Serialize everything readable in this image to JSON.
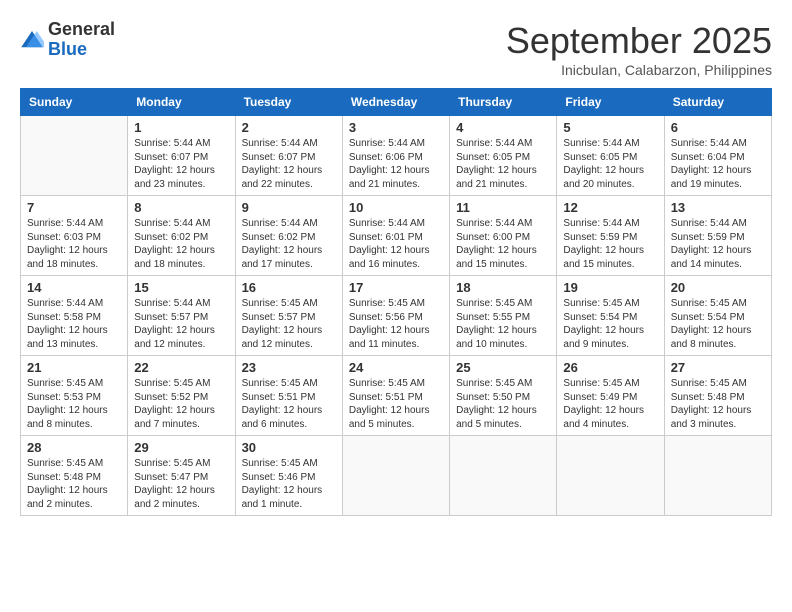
{
  "logo": {
    "general": "General",
    "blue": "Blue"
  },
  "title": "September 2025",
  "location": "Inicbulan, Calabarzon, Philippines",
  "days_of_week": [
    "Sunday",
    "Monday",
    "Tuesday",
    "Wednesday",
    "Thursday",
    "Friday",
    "Saturday"
  ],
  "weeks": [
    [
      {
        "day": "",
        "info": ""
      },
      {
        "day": "1",
        "info": "Sunrise: 5:44 AM\nSunset: 6:07 PM\nDaylight: 12 hours\nand 23 minutes."
      },
      {
        "day": "2",
        "info": "Sunrise: 5:44 AM\nSunset: 6:07 PM\nDaylight: 12 hours\nand 22 minutes."
      },
      {
        "day": "3",
        "info": "Sunrise: 5:44 AM\nSunset: 6:06 PM\nDaylight: 12 hours\nand 21 minutes."
      },
      {
        "day": "4",
        "info": "Sunrise: 5:44 AM\nSunset: 6:05 PM\nDaylight: 12 hours\nand 21 minutes."
      },
      {
        "day": "5",
        "info": "Sunrise: 5:44 AM\nSunset: 6:05 PM\nDaylight: 12 hours\nand 20 minutes."
      },
      {
        "day": "6",
        "info": "Sunrise: 5:44 AM\nSunset: 6:04 PM\nDaylight: 12 hours\nand 19 minutes."
      }
    ],
    [
      {
        "day": "7",
        "info": "Sunrise: 5:44 AM\nSunset: 6:03 PM\nDaylight: 12 hours\nand 18 minutes."
      },
      {
        "day": "8",
        "info": "Sunrise: 5:44 AM\nSunset: 6:02 PM\nDaylight: 12 hours\nand 18 minutes."
      },
      {
        "day": "9",
        "info": "Sunrise: 5:44 AM\nSunset: 6:02 PM\nDaylight: 12 hours\nand 17 minutes."
      },
      {
        "day": "10",
        "info": "Sunrise: 5:44 AM\nSunset: 6:01 PM\nDaylight: 12 hours\nand 16 minutes."
      },
      {
        "day": "11",
        "info": "Sunrise: 5:44 AM\nSunset: 6:00 PM\nDaylight: 12 hours\nand 15 minutes."
      },
      {
        "day": "12",
        "info": "Sunrise: 5:44 AM\nSunset: 5:59 PM\nDaylight: 12 hours\nand 15 minutes."
      },
      {
        "day": "13",
        "info": "Sunrise: 5:44 AM\nSunset: 5:59 PM\nDaylight: 12 hours\nand 14 minutes."
      }
    ],
    [
      {
        "day": "14",
        "info": "Sunrise: 5:44 AM\nSunset: 5:58 PM\nDaylight: 12 hours\nand 13 minutes."
      },
      {
        "day": "15",
        "info": "Sunrise: 5:44 AM\nSunset: 5:57 PM\nDaylight: 12 hours\nand 12 minutes."
      },
      {
        "day": "16",
        "info": "Sunrise: 5:45 AM\nSunset: 5:57 PM\nDaylight: 12 hours\nand 12 minutes."
      },
      {
        "day": "17",
        "info": "Sunrise: 5:45 AM\nSunset: 5:56 PM\nDaylight: 12 hours\nand 11 minutes."
      },
      {
        "day": "18",
        "info": "Sunrise: 5:45 AM\nSunset: 5:55 PM\nDaylight: 12 hours\nand 10 minutes."
      },
      {
        "day": "19",
        "info": "Sunrise: 5:45 AM\nSunset: 5:54 PM\nDaylight: 12 hours\nand 9 minutes."
      },
      {
        "day": "20",
        "info": "Sunrise: 5:45 AM\nSunset: 5:54 PM\nDaylight: 12 hours\nand 8 minutes."
      }
    ],
    [
      {
        "day": "21",
        "info": "Sunrise: 5:45 AM\nSunset: 5:53 PM\nDaylight: 12 hours\nand 8 minutes."
      },
      {
        "day": "22",
        "info": "Sunrise: 5:45 AM\nSunset: 5:52 PM\nDaylight: 12 hours\nand 7 minutes."
      },
      {
        "day": "23",
        "info": "Sunrise: 5:45 AM\nSunset: 5:51 PM\nDaylight: 12 hours\nand 6 minutes."
      },
      {
        "day": "24",
        "info": "Sunrise: 5:45 AM\nSunset: 5:51 PM\nDaylight: 12 hours\nand 5 minutes."
      },
      {
        "day": "25",
        "info": "Sunrise: 5:45 AM\nSunset: 5:50 PM\nDaylight: 12 hours\nand 5 minutes."
      },
      {
        "day": "26",
        "info": "Sunrise: 5:45 AM\nSunset: 5:49 PM\nDaylight: 12 hours\nand 4 minutes."
      },
      {
        "day": "27",
        "info": "Sunrise: 5:45 AM\nSunset: 5:48 PM\nDaylight: 12 hours\nand 3 minutes."
      }
    ],
    [
      {
        "day": "28",
        "info": "Sunrise: 5:45 AM\nSunset: 5:48 PM\nDaylight: 12 hours\nand 2 minutes."
      },
      {
        "day": "29",
        "info": "Sunrise: 5:45 AM\nSunset: 5:47 PM\nDaylight: 12 hours\nand 2 minutes."
      },
      {
        "day": "30",
        "info": "Sunrise: 5:45 AM\nSunset: 5:46 PM\nDaylight: 12 hours\nand 1 minute."
      },
      {
        "day": "",
        "info": ""
      },
      {
        "day": "",
        "info": ""
      },
      {
        "day": "",
        "info": ""
      },
      {
        "day": "",
        "info": ""
      }
    ]
  ]
}
